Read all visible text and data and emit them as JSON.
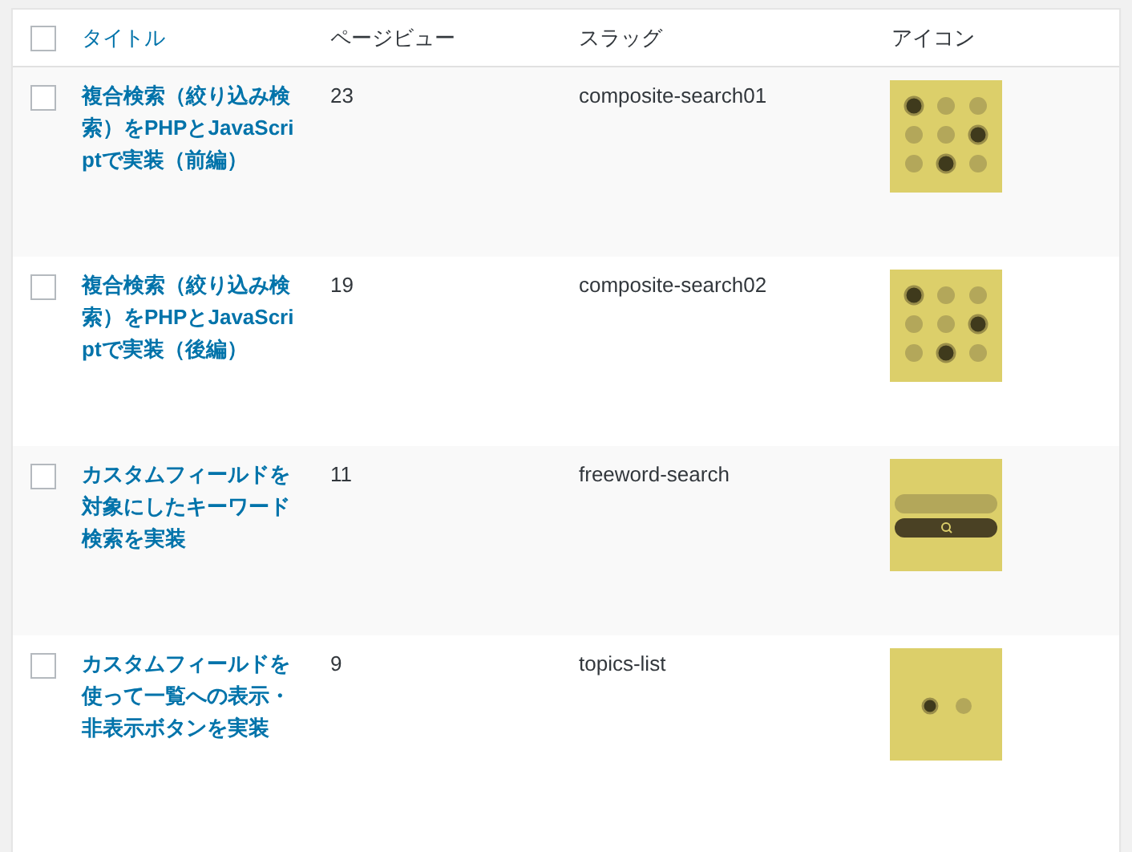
{
  "table": {
    "select_all": {
      "checked": false
    },
    "columns": [
      "タイトル",
      "ページビュー",
      "スラッグ",
      "アイコン"
    ],
    "rows": [
      {
        "checked": false,
        "title": "複合検索（絞り込み検索）をPHPとJavaScriptで実装（前編）",
        "page_views": "23",
        "slug": "composite-search01",
        "icon": {
          "kind": "dot-grid"
        }
      },
      {
        "checked": false,
        "title": "複合検索（絞り込み検索）をPHPとJavaScriptで実装（後編）",
        "page_views": "19",
        "slug": "composite-search02",
        "icon": {
          "kind": "dot-grid"
        }
      },
      {
        "checked": false,
        "title": "カスタムフィールドを対象にしたキーワード検索を実装",
        "page_views": "11",
        "slug": "freeword-search",
        "icon": {
          "kind": "search-bar"
        }
      },
      {
        "checked": false,
        "title": "カスタムフィールドを使って一覧への表示・非表示ボタンを実装",
        "page_views": "9",
        "slug": "topics-list",
        "icon": {
          "kind": "two-dots"
        }
      }
    ]
  }
}
